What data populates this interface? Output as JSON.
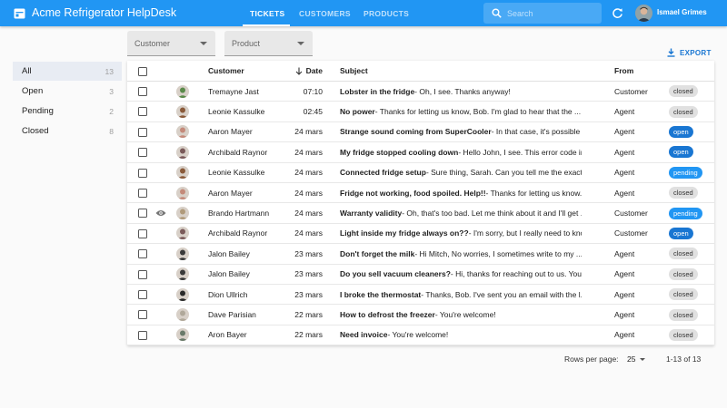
{
  "app": {
    "title": "Acme Refrigerator HelpDesk",
    "accent_color": "#2196f3",
    "logo_icon": "calendar-icon"
  },
  "nav": {
    "tickets": "TICKETS",
    "customers": "CUSTOMERS",
    "products": "PRODUCTS",
    "active": "TICKETS"
  },
  "search": {
    "placeholder": "Search",
    "value": ""
  },
  "user": {
    "name": "Ismael Grimes"
  },
  "filters": {
    "customer_label": "Customer",
    "product_label": "Product"
  },
  "export_label": "EXPORT",
  "sidebar": {
    "items": [
      {
        "label": "All",
        "count": "13",
        "active": true
      },
      {
        "label": "Open",
        "count": "3",
        "active": false
      },
      {
        "label": "Pending",
        "count": "2",
        "active": false
      },
      {
        "label": "Closed",
        "count": "8",
        "active": false
      }
    ]
  },
  "table": {
    "headers": {
      "customer": "Customer",
      "date": "Date",
      "subject": "Subject",
      "from": "From"
    },
    "rows": [
      {
        "customer": "Tremayne Jast",
        "date": "07:10",
        "subject_title": "Lobster in the fridge",
        "subject_rest": " - Oh, I see. Thanks anyway!",
        "from": "Customer",
        "status": "closed",
        "avatar_color": "#5a8a4a",
        "eye": false
      },
      {
        "customer": "Leonie Kassulke",
        "date": "02:45",
        "subject_title": "No power",
        "subject_rest": " - Thanks for letting us know, Bob. I'm glad to hear that the ...",
        "from": "Agent",
        "status": "closed",
        "avatar_color": "#8a5a3a",
        "eye": false
      },
      {
        "customer": "Aaron Mayer",
        "date": "24 mars",
        "subject_title": "Strange sound coming from SuperCooler",
        "subject_rest": " - In that case, it's possible t...",
        "from": "Agent",
        "status": "open",
        "avatar_color": "#c48a7a",
        "eye": false
      },
      {
        "customer": "Archibald Raynor",
        "date": "24 mars",
        "subject_title": "My fridge stopped cooling down",
        "subject_rest": " - Hello John, I see. This error code in...",
        "from": "Agent",
        "status": "open",
        "avatar_color": "#7a5a5a",
        "eye": false
      },
      {
        "customer": "Leonie Kassulke",
        "date": "24 mars",
        "subject_title": "Connected fridge setup",
        "subject_rest": " - Sure thing, Sarah. Can you tell me the exact ...",
        "from": "Agent",
        "status": "pending",
        "avatar_color": "#8a5a3a",
        "eye": false
      },
      {
        "customer": "Aaron Mayer",
        "date": "24 mars",
        "subject_title": "Fridge not working, food spoiled. Help!!",
        "subject_rest": " - Thanks for letting us know. ...",
        "from": "Agent",
        "status": "closed",
        "avatar_color": "#c48a7a",
        "eye": false
      },
      {
        "customer": "Brando Hartmann",
        "date": "24 mars",
        "subject_title": "Warranty validity",
        "subject_rest": " - Oh, that's too bad. Let me think about it and I'll get ...",
        "from": "Customer",
        "status": "pending",
        "avatar_color": "#b09a7a",
        "eye": true
      },
      {
        "customer": "Archibald Raynor",
        "date": "24 mars",
        "subject_title": "Light inside my fridge always on??",
        "subject_rest": " - I'm sorry, but I really need to know ...",
        "from": "Customer",
        "status": "open",
        "avatar_color": "#7a5a5a",
        "eye": false
      },
      {
        "customer": "Jalon Bailey",
        "date": "23 mars",
        "subject_title": "Don't forget the milk",
        "subject_rest": " - Hi Mitch, No worries, I sometimes write to my ...",
        "from": "Agent",
        "status": "closed",
        "avatar_color": "#3a3a3a",
        "eye": false
      },
      {
        "customer": "Jalon Bailey",
        "date": "23 mars",
        "subject_title": "Do you sell vacuum cleaners?",
        "subject_rest": " - Hi, thanks for reaching out to us. You ...",
        "from": "Agent",
        "status": "closed",
        "avatar_color": "#3a3a3a",
        "eye": false
      },
      {
        "customer": "Dion Ullrich",
        "date": "23 mars",
        "subject_title": "I broke the thermostat",
        "subject_rest": " - Thanks, Bob. I've sent you an email with the l...",
        "from": "Agent",
        "status": "closed",
        "avatar_color": "#2a2a2a",
        "eye": false
      },
      {
        "customer": "Dave Parisian",
        "date": "22 mars",
        "subject_title": "How to defrost the freezer",
        "subject_rest": " - You're welcome!",
        "from": "Agent",
        "status": "closed",
        "avatar_color": "#b0a89a",
        "eye": false
      },
      {
        "customer": "Aron Bayer",
        "date": "22 mars",
        "subject_title": "Need invoice",
        "subject_rest": " - You're welcome!",
        "from": "Agent",
        "status": "closed",
        "avatar_color": "#6a7a6a",
        "eye": false
      }
    ]
  },
  "pagination": {
    "rows_per_page_label": "Rows per page:",
    "rows_per_page": "25",
    "range": "1-13 of 13"
  },
  "status_colors": {
    "closed": "#e0e0e0",
    "open": "#1976d2",
    "pending": "#2196f3"
  }
}
